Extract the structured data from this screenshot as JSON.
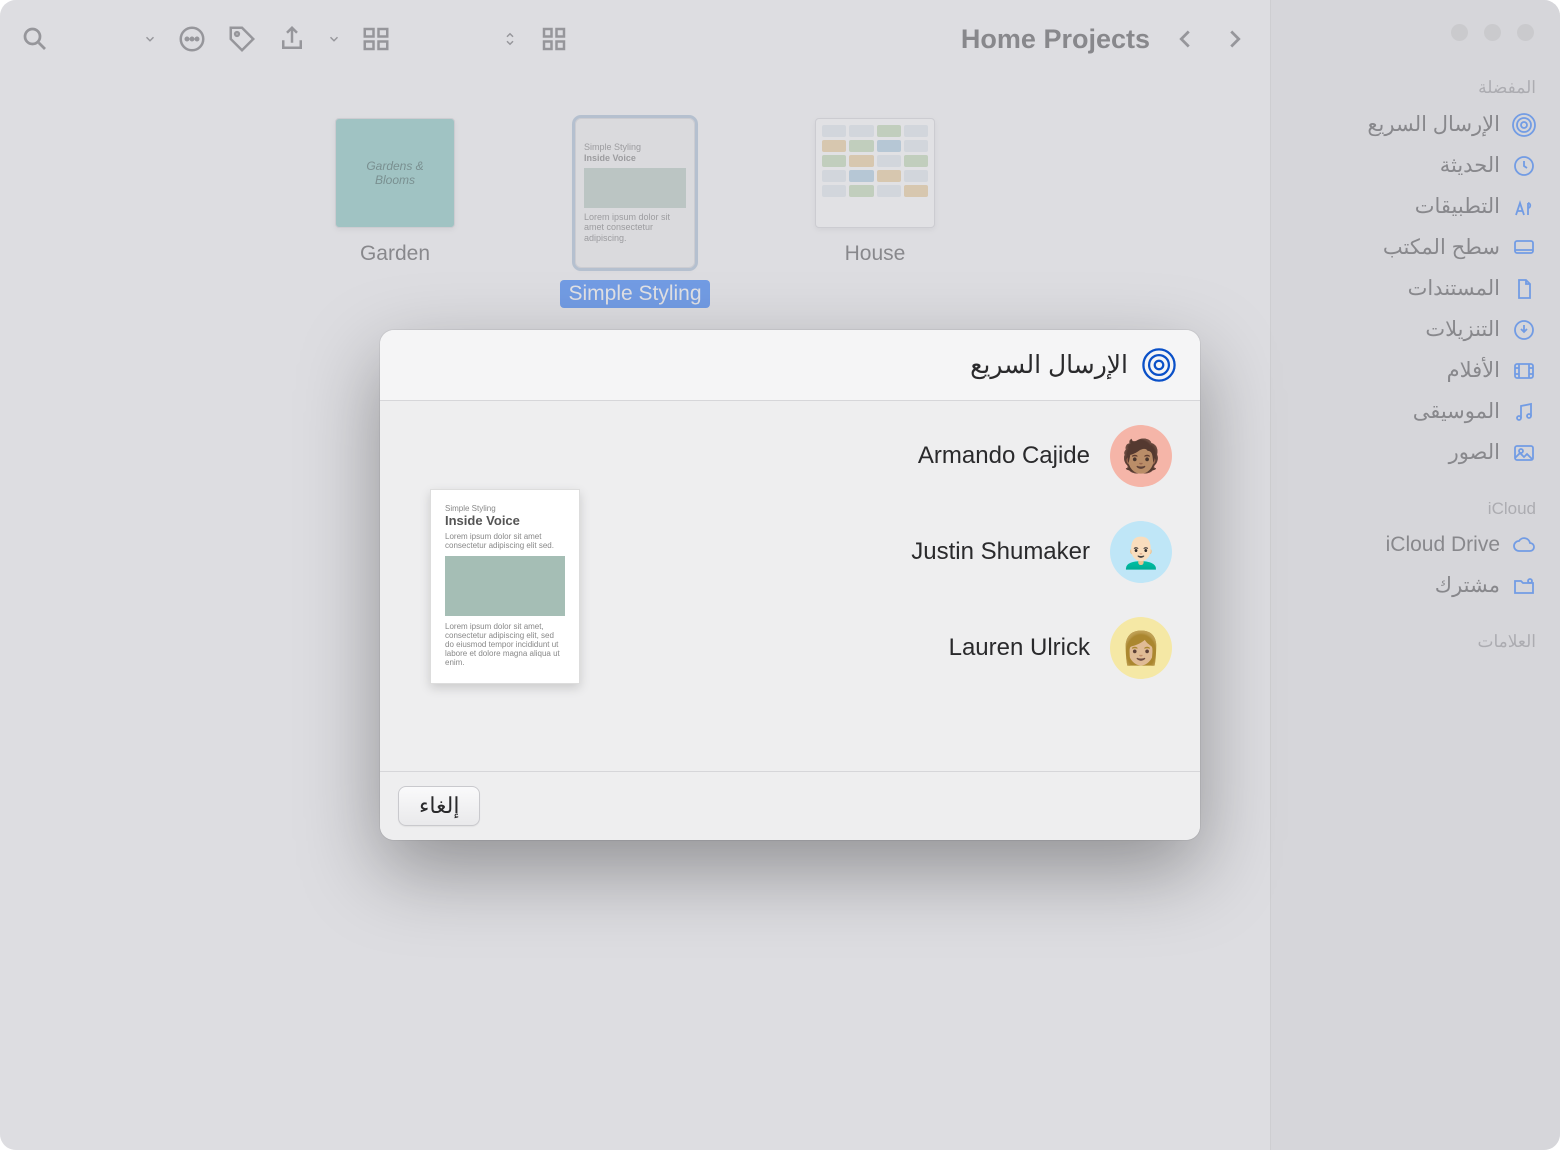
{
  "window": {
    "title": "Home Projects"
  },
  "sidebar": {
    "sections": {
      "favorites": {
        "title": "المفضلة",
        "items": [
          {
            "label": "الإرسال السريع"
          },
          {
            "label": "الحديثة"
          },
          {
            "label": "التطبيقات"
          },
          {
            "label": "سطح المكتب"
          },
          {
            "label": "المستندات"
          },
          {
            "label": "التنزيلات"
          },
          {
            "label": "الأفلام"
          },
          {
            "label": "الموسيقى"
          },
          {
            "label": "الصور"
          }
        ]
      },
      "icloud": {
        "title": "iCloud",
        "items": [
          {
            "label": "iCloud Drive"
          },
          {
            "label": "مشترك"
          }
        ]
      },
      "tags": {
        "title": "العلامات"
      }
    }
  },
  "files": [
    {
      "name": "House",
      "selected": false
    },
    {
      "name": "Simple Styling",
      "selected": true
    },
    {
      "name": "Garden",
      "selected": false,
      "thumb_text": "Gardens & Blooms"
    }
  ],
  "airdrop": {
    "title": "الإرسال السريع",
    "cancel": "إلغاء",
    "preview_title": "Inside Voice",
    "preview_subtitle": "Simple Styling",
    "contacts": [
      {
        "name": "Armando Cajide"
      },
      {
        "name": "Justin Shumaker"
      },
      {
        "name": "Lauren Ulrick"
      }
    ]
  }
}
